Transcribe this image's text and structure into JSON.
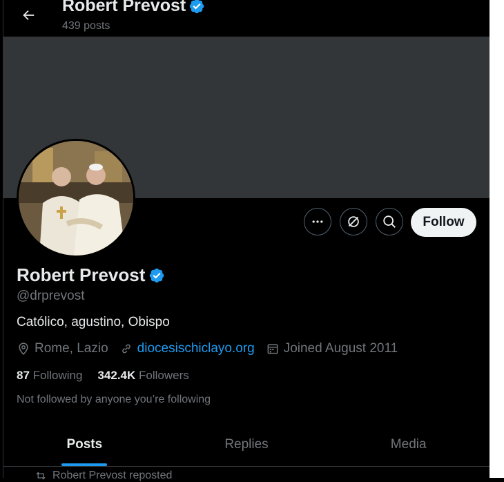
{
  "header": {
    "name": "Robert Prevost",
    "posts_count": "439 posts",
    "back_icon": "arrow-left-icon"
  },
  "profile": {
    "name": "Robert Prevost",
    "handle": "@drprevost",
    "bio": "Católico, agustino, Obispo",
    "location": "Rome, Lazio",
    "website": "diocesischiclayo.org",
    "joined": "Joined August 2011",
    "following_count": "87",
    "following_label": "Following",
    "followers_count": "342.4K",
    "followers_label": "Followers",
    "not_followed": "Not followed by anyone you’re following",
    "verified_icon": "verified-badge-icon"
  },
  "actions": {
    "more_icon": "more-icon",
    "grok_icon": "grok-icon",
    "search_icon": "search-icon",
    "follow_label": "Follow"
  },
  "tabs": [
    {
      "label": "Posts",
      "active": true
    },
    {
      "label": "Replies",
      "active": false
    },
    {
      "label": "Media",
      "active": false
    }
  ],
  "feed": {
    "repost_text": "Robert Prevost reposted"
  },
  "colors": {
    "background": "#000000",
    "banner": "#333639",
    "accent": "#1d9bf0",
    "muted": "#71767b",
    "text": "#e7e9ea"
  }
}
